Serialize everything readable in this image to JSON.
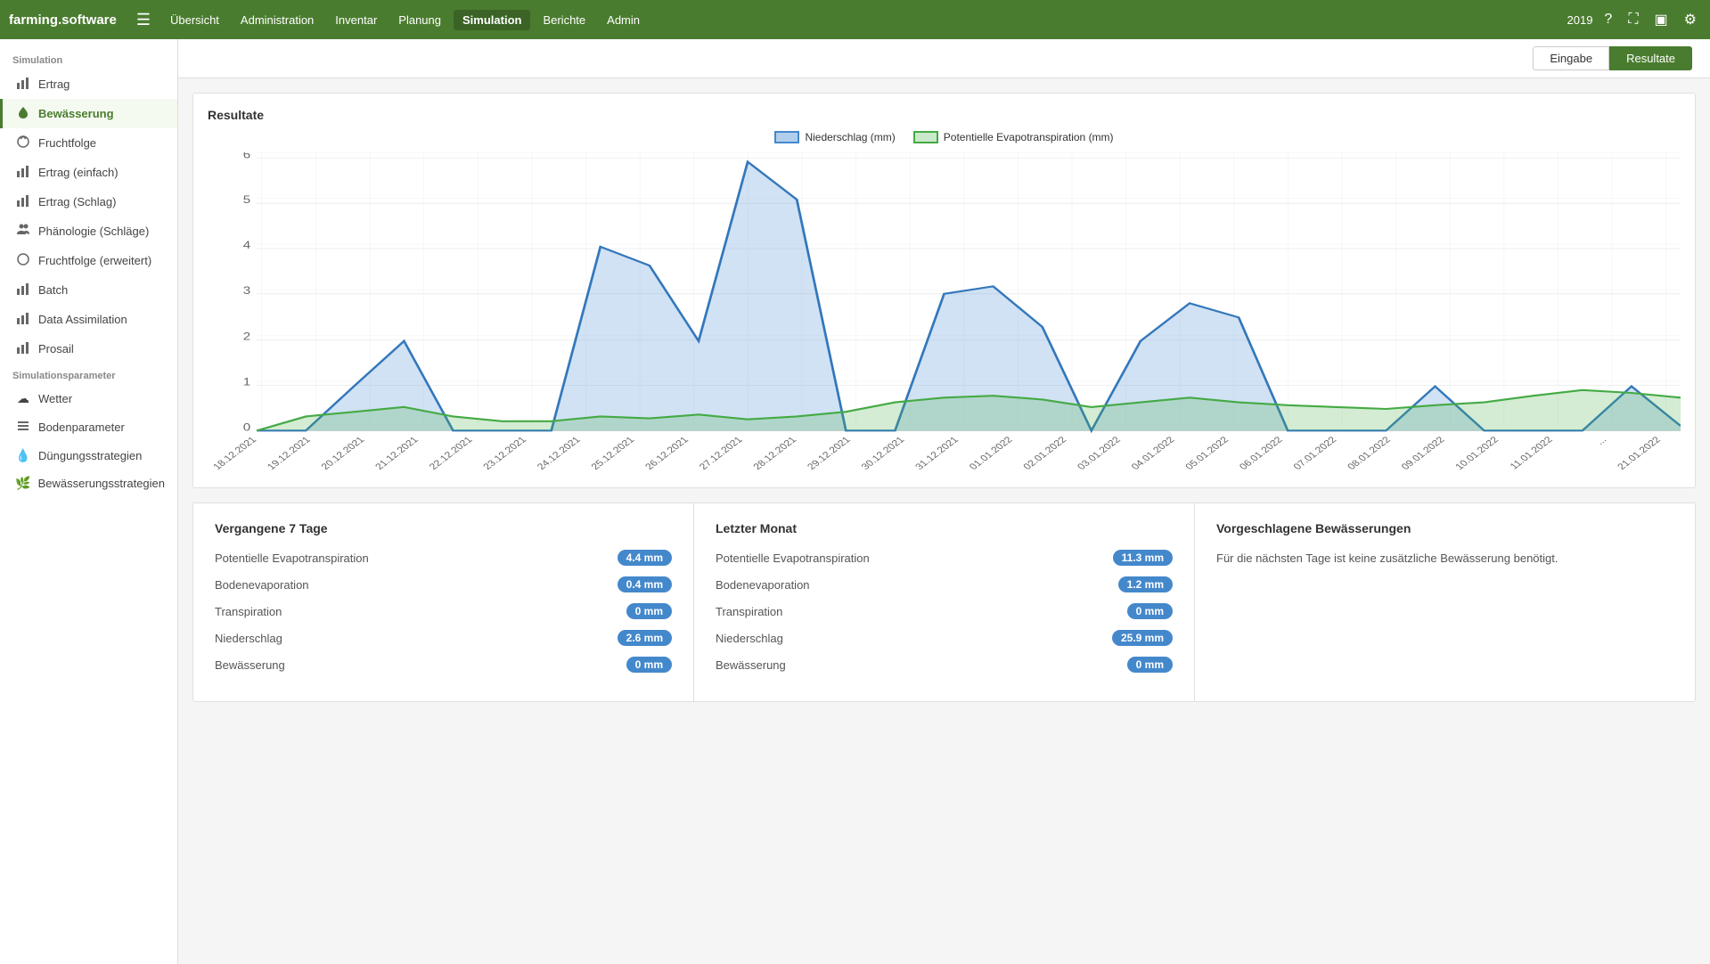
{
  "brand": "farming.software",
  "nav": {
    "year": "2019",
    "items": [
      {
        "label": "Übersicht",
        "active": false
      },
      {
        "label": "Administration",
        "active": false
      },
      {
        "label": "Inventar",
        "active": false
      },
      {
        "label": "Planung",
        "active": false
      },
      {
        "label": "Simulation",
        "active": true
      },
      {
        "label": "Berichte",
        "active": false
      },
      {
        "label": "Admin",
        "active": false
      }
    ]
  },
  "sidebar": {
    "section1": "Simulation",
    "items": [
      {
        "label": "Ertrag",
        "icon": "📊",
        "active": false
      },
      {
        "label": "Bewässerung",
        "icon": "💧",
        "active": true
      },
      {
        "label": "Fruchtfolge",
        "icon": "🔄",
        "active": false
      },
      {
        "label": "Ertrag (einfach)",
        "icon": "📊",
        "active": false
      },
      {
        "label": "Ertrag (Schlag)",
        "icon": "📊",
        "active": false
      },
      {
        "label": "Phänologie (Schläge)",
        "icon": "👥",
        "active": false
      },
      {
        "label": "Fruchtfolge (erweitert)",
        "icon": "🔄",
        "active": false
      },
      {
        "label": "Batch",
        "icon": "📊",
        "active": false
      },
      {
        "label": "Data Assimilation",
        "icon": "📊",
        "active": false
      },
      {
        "label": "Prosail",
        "icon": "📊",
        "active": false
      }
    ],
    "section2": "Simulationsparameter",
    "items2": [
      {
        "label": "Wetter",
        "icon": "☁️",
        "active": false
      },
      {
        "label": "Bodenparameter",
        "icon": "📋",
        "active": false
      },
      {
        "label": "Düngungsstrategien",
        "icon": "💧",
        "active": false
      },
      {
        "label": "Bewässerungsstrategien",
        "icon": "🌿",
        "active": false
      }
    ]
  },
  "tabs": {
    "eingabe": "Eingabe",
    "resultate": "Resultate"
  },
  "chart": {
    "title": "Resultate",
    "legend_blue": "Niederschlag (mm)",
    "legend_green": "Potentielle Evapotranspiration (mm)"
  },
  "stats": {
    "panel1": {
      "title": "Vergangene 7 Tage",
      "rows": [
        {
          "label": "Potentielle Evapotranspiration",
          "value": "4.4 mm"
        },
        {
          "label": "Bodenevaporation",
          "value": "0.4 mm"
        },
        {
          "label": "Transpiration",
          "value": "0 mm"
        },
        {
          "label": "Niederschlag",
          "value": "2.6 mm"
        },
        {
          "label": "Bewässerung",
          "value": "0 mm"
        }
      ]
    },
    "panel2": {
      "title": "Letzter Monat",
      "rows": [
        {
          "label": "Potentielle Evapotranspiration",
          "value": "11.3 mm"
        },
        {
          "label": "Bodenevaporation",
          "value": "1.2 mm"
        },
        {
          "label": "Transpiration",
          "value": "0 mm"
        },
        {
          "label": "Niederschlag",
          "value": "25.9 mm"
        },
        {
          "label": "Bewässerung",
          "value": "0 mm"
        }
      ]
    },
    "panel3": {
      "title": "Vorgeschlagene Bewässerungen",
      "text": "Für die nächsten Tage ist keine zusätzliche Bewässerung benötigt."
    }
  }
}
